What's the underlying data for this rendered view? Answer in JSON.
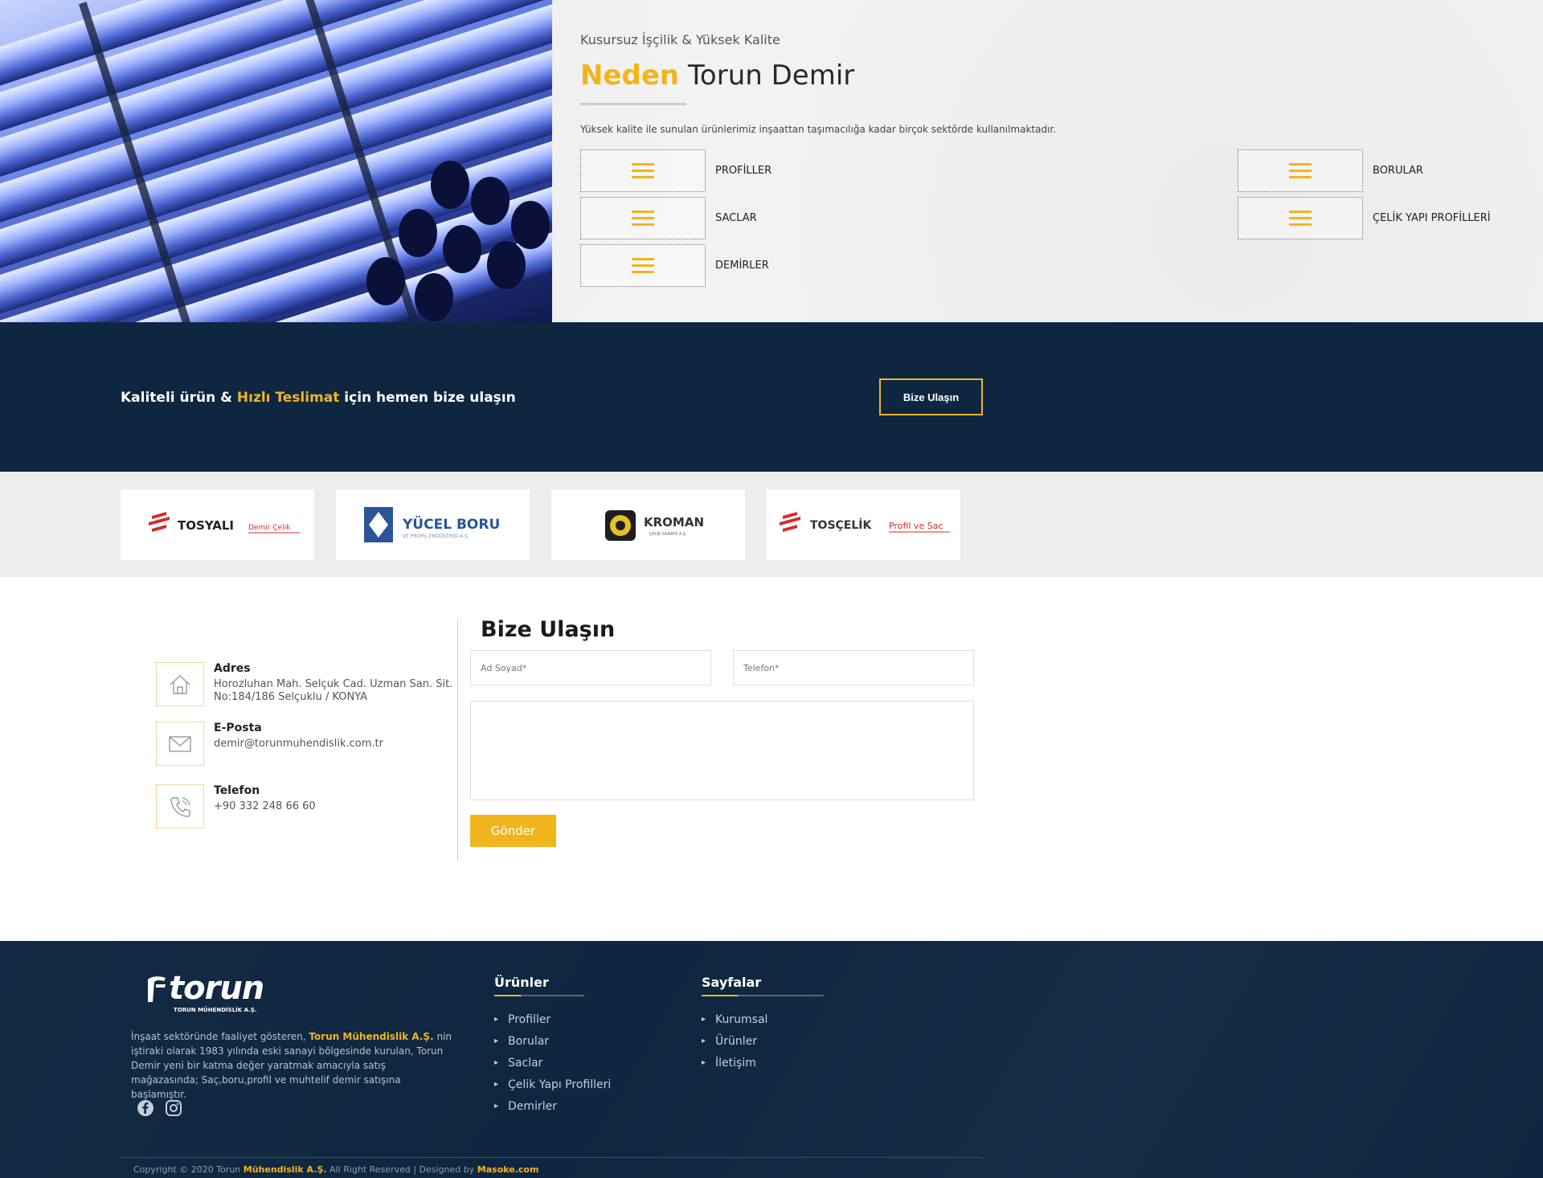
{
  "why": {
    "subtitle": "Kusursuz İşçilik & Yüksek Kalite",
    "title_accent": "Neden",
    "title_rest": "Torun Demir",
    "description": "Yüksek kalite ile sunulan ürünlerimiz inşaattan taşımacılığa kadar birçok sektörde kullanılmaktadır.",
    "categories": [
      {
        "label": "PROFİLLER"
      },
      {
        "label": "SACLAR"
      },
      {
        "label": "DEMİRLER"
      },
      {
        "label": "BORULAR"
      },
      {
        "label": "ÇELİK YAPI PROFİLLERİ"
      }
    ],
    "category_icon": "menu-icon"
  },
  "cta": {
    "text_before": "Kaliteli ürün & ",
    "text_accent": "Hızlı Teslimat",
    "text_after": " için hemen bize ulaşın",
    "button": "Bize Ulaşın"
  },
  "brands": [
    {
      "name": "TOSYALI",
      "sub": "Demir Çelik",
      "color": "#d52b2b"
    },
    {
      "name": "YÜCEL BORU",
      "sub": "VE PROFİL ENDÜSTRİSİ A.Ş.",
      "color": "#2a5599"
    },
    {
      "name": "KROMAN",
      "sub": "ÇELİK SANAYİİ A.Ş.",
      "color": "#333333"
    },
    {
      "name": "TOSÇELİK",
      "sub": "Profil ve Sac",
      "color": "#d52b2b"
    }
  ],
  "contact": {
    "address_title": "Adres",
    "address_text": "Horozluhan Mah. Selçuk Cad. Uzman San. Sit. No:184/186 Selçuklu / KONYA",
    "email_title": "E-Posta",
    "email_text": "demir@torunmuhendislik.com.tr",
    "phone_title": "Telefon",
    "phone_text": "+90 332 248 66 60",
    "form_title": "Bize Ulaşın",
    "name_placeholder": "Ad Soyad*",
    "phone_placeholder": "Telefon*",
    "submit": "Gönder"
  },
  "footer": {
    "logo_word": "torun",
    "logo_sub": "TORUN MÜHENDİSLİK A.Ş.",
    "about_1": "İnşaat sektöründe faaliyet gösteren, ",
    "about_accent": "Torun Mühendislik A.Ş.",
    "about_2": " nin iştiraki olarak 1983 yılında eski sanayi bölgesinde kurulan, Torun Demir yeni bir katma değer yaratmak amacıyla satış mağazasında; Saç,boru,profil ve muhtelif demir satışına başlamıştır.",
    "products_title": "Ürünler",
    "products": [
      "Profiller",
      "Borular",
      "Saclar",
      "Çelik Yapı Profilleri",
      "Demirler"
    ],
    "pages_title": "Sayfalar",
    "pages": [
      "Kurumsal",
      "Ürünler",
      "İletişim"
    ],
    "copyright_1": "Copyright © 2020 Torun ",
    "copyright_accent": "Mühendislik A.Ş.",
    "copyright_2": " All Right Reserved | Designed by ",
    "copyright_designer": "Masoke.com"
  },
  "colors": {
    "accent": "#f1b51c",
    "navy": "#0f2640"
  }
}
